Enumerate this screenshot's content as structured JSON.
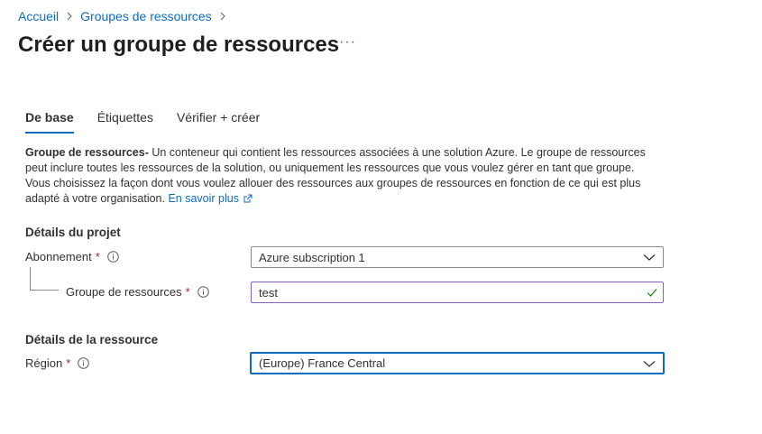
{
  "breadcrumb": [
    {
      "label": "Accueil"
    },
    {
      "label": "Groupes de ressources"
    }
  ],
  "title": "Créer un groupe de ressources",
  "more_label": "···",
  "tabs": [
    {
      "label": "De base",
      "active": true
    },
    {
      "label": "Étiquettes",
      "active": false
    },
    {
      "label": "Vérifier + créer",
      "active": false
    }
  ],
  "description": {
    "bold": "Groupe de ressources-",
    "text": " Un conteneur qui contient les ressources associées à une solution Azure. Le groupe de ressources peut inclure toutes les ressources de la solution, ou uniquement les ressources que vous voulez gérer en tant que groupe. Vous choisissez la façon dont vous voulez allouer des ressources aux groupes de ressources en fonction de ce qui est plus adapté à votre organisation. ",
    "link": "En savoir plus"
  },
  "project": {
    "heading": "Détails du projet",
    "subscription_label": "Abonnement",
    "subscription_value": "Azure subscription 1",
    "rg_label": "Groupe de ressources",
    "rg_value": "test"
  },
  "resource": {
    "heading": "Détails de la ressource",
    "region_label": "Région",
    "region_value": "(Europe) France Central"
  },
  "required_mark": "*",
  "colors": {
    "accent": "#0f6cbd",
    "required": "#a4262c",
    "valid": "#107c10"
  }
}
